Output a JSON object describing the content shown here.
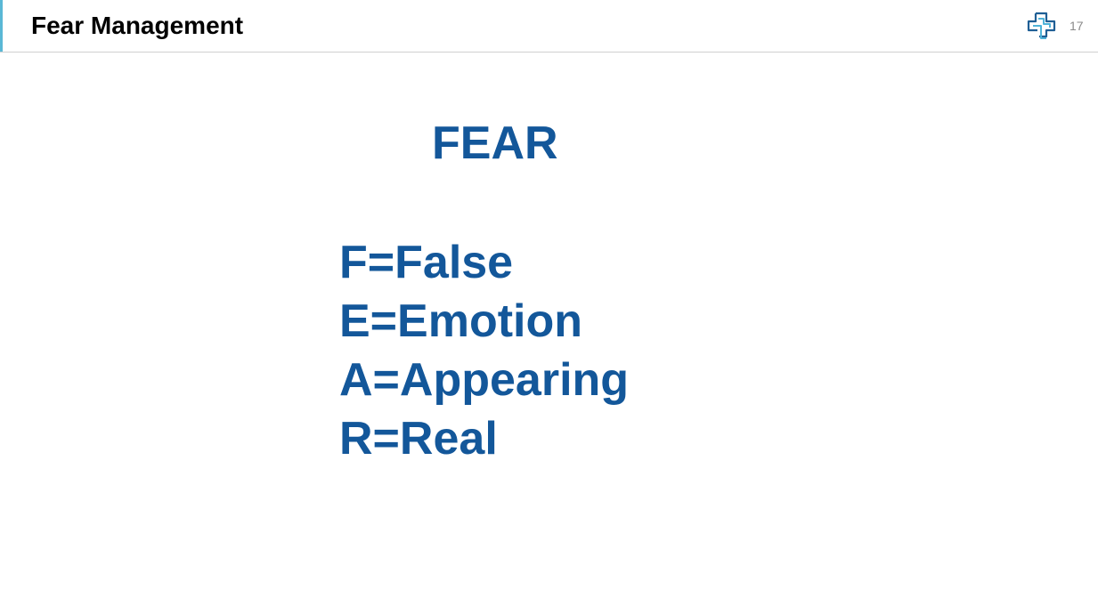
{
  "header": {
    "title": "Fear Management",
    "page_number": "17",
    "logo_icon": "cross-logo-icon",
    "accent_color": "#5ab8d6"
  },
  "slide": {
    "title": "FEAR",
    "lines": [
      "F=False",
      "E=Emotion",
      "A=Appearing",
      "R=Real"
    ],
    "text_color": "#13579a"
  }
}
